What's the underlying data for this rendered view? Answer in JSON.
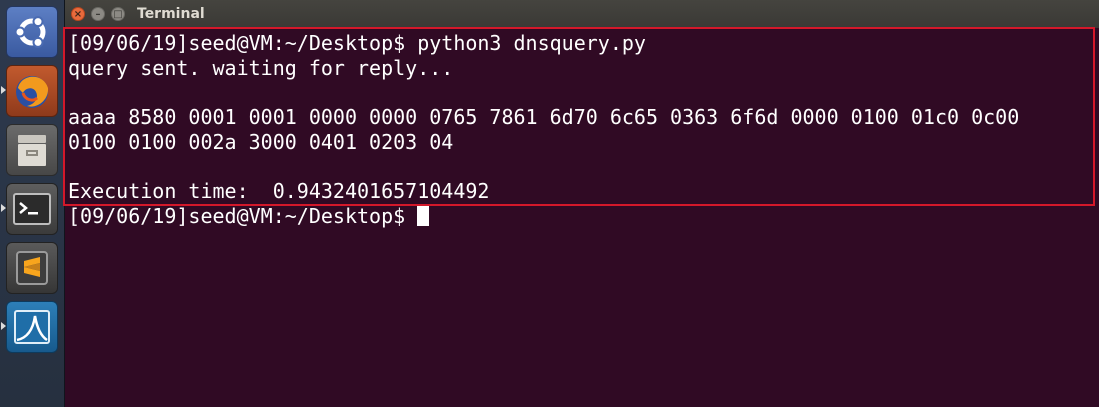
{
  "window": {
    "title": "Terminal",
    "close_glyph": "×",
    "minimize_glyph": "–",
    "maximize_glyph": "□"
  },
  "launcher": {
    "items": [
      {
        "name": "ubuntu-dash",
        "icon": "ubuntu-logo-icon",
        "running": false
      },
      {
        "name": "firefox",
        "icon": "firefox-icon",
        "running": true
      },
      {
        "name": "files",
        "icon": "file-cabinet-icon",
        "running": false
      },
      {
        "name": "terminal",
        "icon": "terminal-icon",
        "running": true
      },
      {
        "name": "sublime-text",
        "icon": "sublime-text-icon",
        "running": false
      },
      {
        "name": "wireshark",
        "icon": "wireshark-fin-icon",
        "running": true
      }
    ]
  },
  "terminal": {
    "lines": [
      "[09/06/19]seed@VM:~/Desktop$ python3 dnsquery.py",
      "query sent. waiting for reply...",
      "",
      "aaaa 8580 0001 0001 0000 0000 0765 7861 6d70 6c65 0363 6f6d 0000 0100 01c0 0c00",
      "0100 0100 002a 3000 0401 0203 04",
      "",
      "Execution time:  0.9432401657104492",
      "[09/06/19]seed@VM:~/Desktop$"
    ],
    "colors": {
      "background": "#300a24",
      "text": "#ffffff",
      "highlight_border": "#d4182a"
    }
  }
}
